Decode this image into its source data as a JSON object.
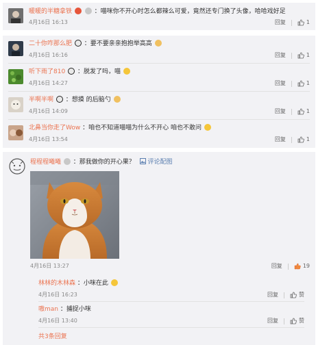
{
  "top_comment": {
    "name": "暖暖的半糖拿铁",
    "text": "：喵咪你不开心时怎么都辣么可爱，竟然还专门换了头像，哈哈戏好足",
    "time": "4月16日 16:13",
    "reply_label": "回复",
    "likes": "1"
  },
  "comments": [
    {
      "name": "二十你咋那么肥",
      "text": "：要不要亲亲抱抱举高高",
      "time": "4月16日 16:16",
      "reply_label": "回复",
      "likes": "1"
    },
    {
      "name": "听下雨了810",
      "text": "：脱发了吗，喵",
      "time": "4月16日 14:27",
      "reply_label": "回复",
      "likes": "1"
    },
    {
      "name": "半啊半啊",
      "text": "：想摸 的后脑勺",
      "time": "4月16日 14:09",
      "reply_label": "回复",
      "likes": "1"
    },
    {
      "name": "北鼻当你走了Wow",
      "text": "：咱也不知道喵喵为什么不开心 咱也不敢问",
      "time": "4月16日 13:54",
      "reply_label": "回复",
      "likes": "1"
    }
  ],
  "main_comment": {
    "name": "程程程曦曦",
    "text": "：那我做你的开心果？",
    "pic_label": "评论配图",
    "time": "4月16日 13:27",
    "reply_label": "回复",
    "likes": "19"
  },
  "sub_replies": [
    {
      "name": "林林的木林森",
      "text": "：小咪在此",
      "time": "4月16日 16:23",
      "reply_label": "回复",
      "like_label": "赞"
    },
    {
      "name": "嗷man",
      "text": "：捕捉小咪",
      "time": "4月16日 13:40",
      "reply_label": "回复",
      "like_label": "赞"
    }
  ],
  "more_replies": "共3条回复",
  "colors": {
    "accent": "#eb7350",
    "background_card": "#f2f2f5"
  }
}
